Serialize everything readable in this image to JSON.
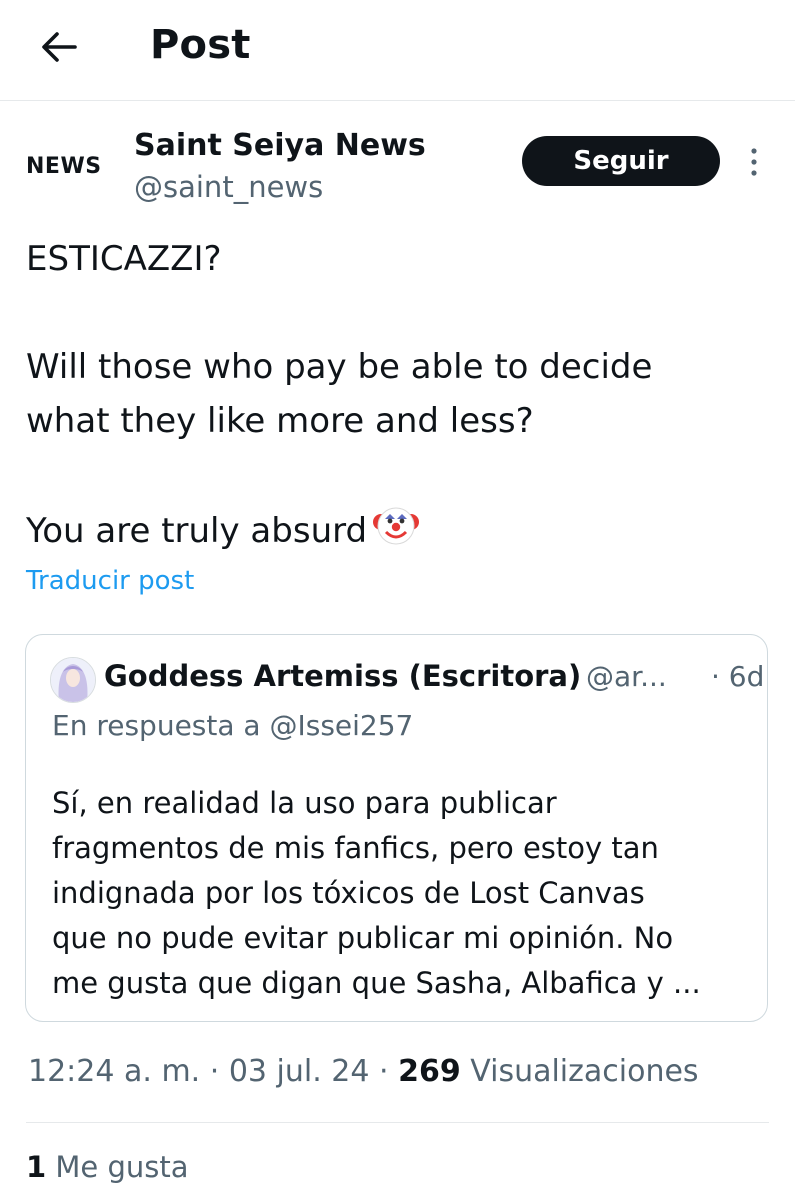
{
  "header": {
    "title": "Post",
    "back_icon": "arrow-left-icon"
  },
  "author": {
    "logo_text": "NEWS",
    "display_name": "Saint Seiya News",
    "handle": "@saint_news",
    "follow_label": "Seguir",
    "more_icon": "more-vertical-icon"
  },
  "post": {
    "line1": "ESTICAZZI?",
    "line2": "Will those who pay be able to decide",
    "line3": "what they like more and less?",
    "line4": "You are truly absurd",
    "emoji_icon": "clown-face-icon",
    "translate_label": "Traducir post"
  },
  "quote": {
    "name": "Goddess Artemiss (Escritora)",
    "handle": "@ar...",
    "time": "· 6d",
    "reply_to": "En respuesta a @Issei257",
    "body_lines": [
      "Sí, en realidad la uso para publicar",
      "fragmentos de mis fanfics, pero estoy tan",
      "indignada por los tóxicos de Lost Canvas",
      "que no pude evitar publicar mi opinión. No",
      "me gusta que digan que Sasha, Albafica y ..."
    ]
  },
  "meta": {
    "time": "12:24 a. m.",
    "sep1": " · ",
    "date": "03 jul. 24",
    "sep2": " · ",
    "views_count": "269",
    "views_label": " Visualizaciones"
  },
  "likes": {
    "count": "1",
    "label": " Me gusta"
  }
}
